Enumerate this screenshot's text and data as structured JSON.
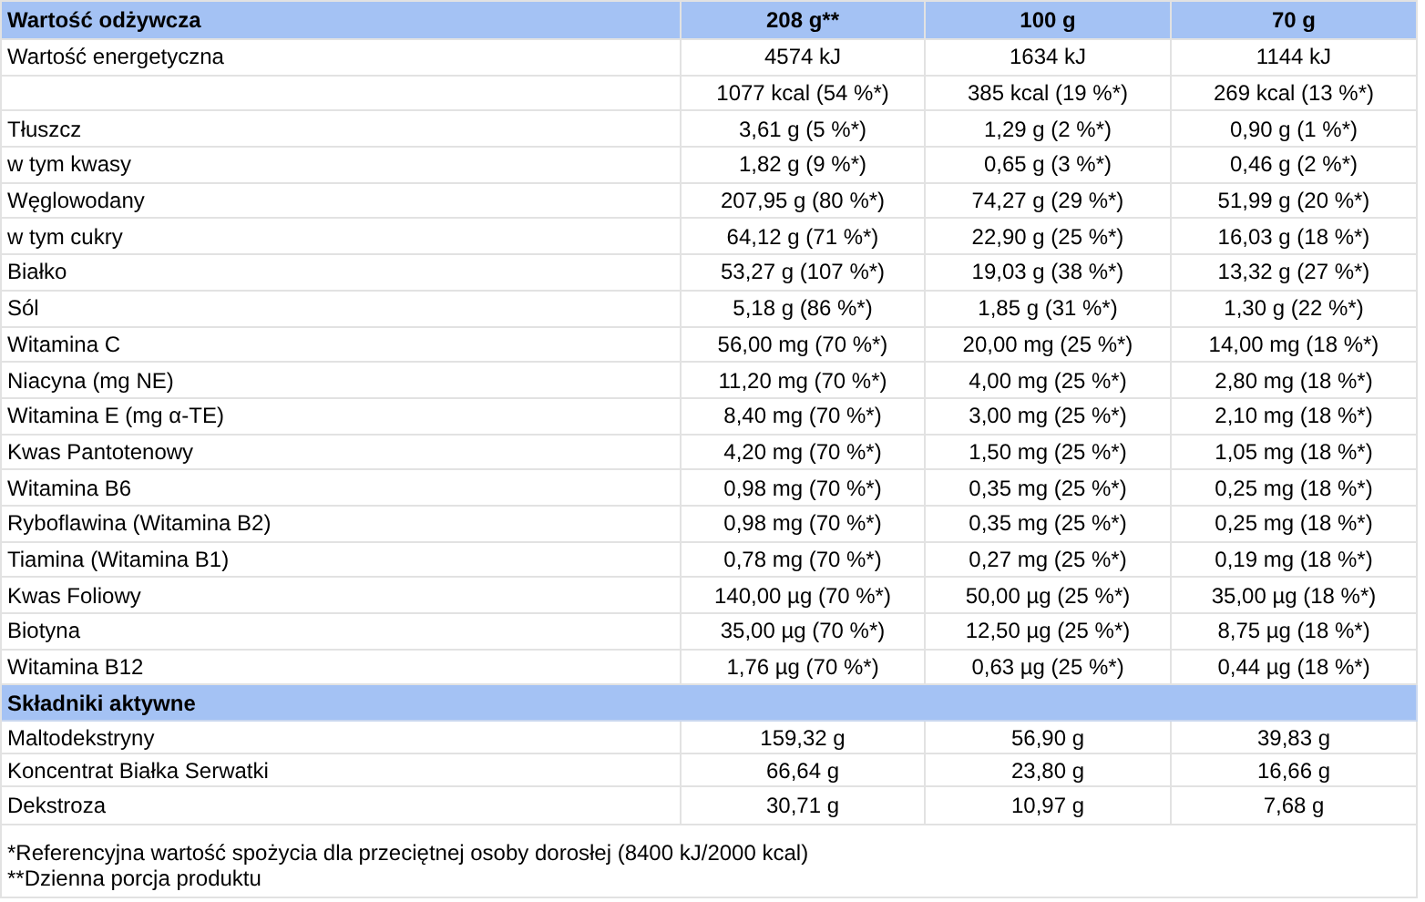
{
  "nutrition": {
    "columns": [
      "Wartość odżywcza",
      "208 g**",
      "100 g",
      "70 g"
    ],
    "rows": [
      {
        "label": "Wartość energetyczna",
        "values": [
          "4574 kJ",
          "1634 kJ",
          "1144 kJ"
        ]
      },
      {
        "values": [
          "1077 kcal (54 %*)",
          "385 kcal (19 %*)",
          "269 kcal (13 %*)"
        ]
      },
      {
        "label": "Tłuszcz",
        "values": [
          "3,61 g (5 %*)",
          "1,29 g (2 %*)",
          "0,90 g (1 %*)"
        ]
      },
      {
        "label": "w tym kwasy",
        "values": [
          "1,82 g (9 %*)",
          "0,65 g (3 %*)",
          "0,46 g (2 %*)"
        ]
      },
      {
        "label": "Węglowodany",
        "values": [
          "207,95 g (80 %*)",
          "74,27 g (29 %*)",
          "51,99 g (20 %*)"
        ]
      },
      {
        "label": "w tym cukry",
        "values": [
          "64,12 g (71 %*)",
          "22,90 g (25 %*)",
          "16,03 g (18 %*)"
        ]
      },
      {
        "label": "Białko",
        "values": [
          "53,27 g (107 %*)",
          "19,03 g (38 %*)",
          "13,32 g (27 %*)"
        ]
      },
      {
        "label": "Sól",
        "values": [
          "5,18 g (86 %*)",
          "1,85 g (31 %*)",
          "1,30 g (22 %*)"
        ]
      },
      {
        "label": "Witamina C",
        "values": [
          "56,00 mg (70 %*)",
          "20,00 mg (25 %*)",
          "14,00 mg (18 %*)"
        ]
      },
      {
        "label": "Niacyna (mg NE)",
        "values": [
          "11,20 mg (70 %*)",
          "4,00 mg (25 %*)",
          "2,80 mg (18 %*)"
        ]
      },
      {
        "label": "Witamina E (mg α-TE)",
        "values": [
          "8,40 mg (70 %*)",
          "3,00 mg (25 %*)",
          "2,10 mg (18 %*)"
        ]
      },
      {
        "label": "Kwas Pantotenowy",
        "values": [
          "4,20 mg (70 %*)",
          "1,50 mg (25 %*)",
          "1,05 mg (18 %*)"
        ]
      },
      {
        "label": "Witamina B6",
        "values": [
          "0,98 mg (70 %*)",
          "0,35 mg (25 %*)",
          "0,25 mg (18 %*)"
        ]
      },
      {
        "label": "Ryboflawina (Witamina B2)",
        "values": [
          "0,98 mg (70 %*)",
          "0,35 mg (25 %*)",
          "0,25 mg (18 %*)"
        ]
      },
      {
        "label": "Tiamina (Witamina B1)",
        "values": [
          "0,78 mg (70 %*)",
          "0,27 mg (25 %*)",
          "0,19 mg (18 %*)"
        ]
      },
      {
        "label": "Kwas Foliowy",
        "values": [
          "140,00 µg (70 %*)",
          "50,00 µg (25 %*)",
          "35,00 µg (18 %*)"
        ]
      },
      {
        "label": "Biotyna",
        "values": [
          "35,00 µg (70 %*)",
          "12,50 µg (25 %*)",
          "8,75 µg (18 %*)"
        ]
      },
      {
        "label": "Witamina B12",
        "values": [
          "1,76 µg (70 %*)",
          "0,63 µg (25 %*)",
          "0,44 µg (18 %*)"
        ]
      }
    ]
  },
  "active_ingredients": {
    "title": "Składniki aktywne",
    "rows": [
      {
        "label": "Maltodekstryny",
        "values": [
          "159,32 g",
          "56,90 g",
          "39,83 g"
        ]
      },
      {
        "label": "Koncentrat Białka Serwatki",
        "values": [
          "66,64 g",
          "23,80 g",
          "16,66 g"
        ]
      },
      {
        "label": "Dekstroza",
        "values": [
          "30,71 g",
          "10,97 g",
          "7,68 g"
        ]
      }
    ]
  },
  "footnotes": [
    "*Referencyjna wartość spożycia dla przeciętnej osoby dorosłej (8400 kJ/2000 kcal)",
    "**Dzienna porcja produktu"
  ]
}
